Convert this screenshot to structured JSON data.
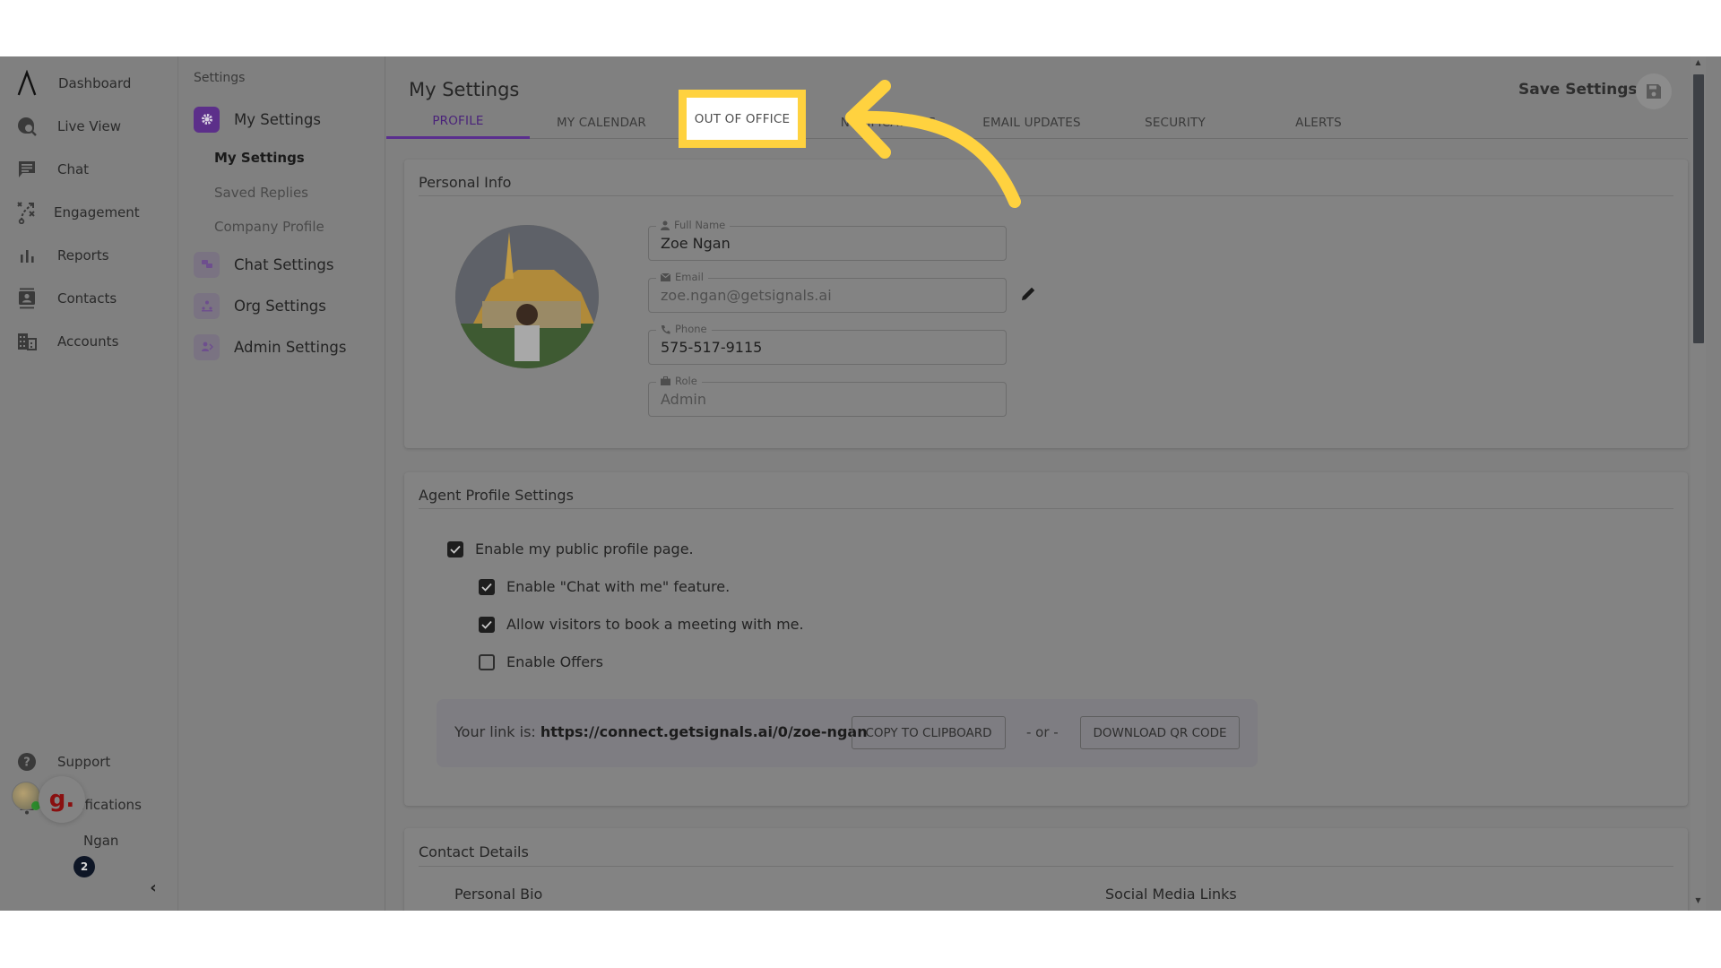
{
  "nav": {
    "items": [
      {
        "label": "Dashboard",
        "icon": "app-logo-icon"
      },
      {
        "label": "Live View",
        "icon": "live-view-icon"
      },
      {
        "label": "Chat",
        "icon": "chat-icon"
      },
      {
        "label": "Engagement",
        "icon": "engagement-icon"
      },
      {
        "label": "Reports",
        "icon": "bar-chart-icon"
      },
      {
        "label": "Contacts",
        "icon": "contacts-icon"
      },
      {
        "label": "Accounts",
        "icon": "building-icon"
      }
    ],
    "bottom": [
      {
        "label": "Support",
        "icon": "help-icon"
      },
      {
        "label": "Notifications",
        "icon": "bell-icon"
      }
    ],
    "user_name": "Ngan",
    "widget_glyph": "g.",
    "widget_badge": "2",
    "collapse_glyph": "‹"
  },
  "subnav": {
    "title": "Settings",
    "groups": [
      {
        "label": "My Settings",
        "active": true
      },
      {
        "label": "Chat Settings"
      },
      {
        "label": "Org Settings"
      },
      {
        "label": "Admin Settings"
      }
    ],
    "items": [
      "My Settings",
      "Saved Replies",
      "Company Profile"
    ]
  },
  "header": {
    "title": "My Settings",
    "save_label": "Save Settings",
    "tabs": [
      "PROFILE",
      "MY CALENDAR",
      "OUT OF OFFICE",
      "NOTIFICATIONS",
      "EMAIL UPDATES",
      "SECURITY",
      "ALERTS"
    ],
    "active_tab": "PROFILE",
    "highlighted_tab": "OUT OF OFFICE"
  },
  "personal_info": {
    "title": "Personal Info",
    "fields": [
      {
        "label": "Full Name",
        "value": "Zoe Ngan",
        "icon": "person-icon"
      },
      {
        "label": "Email",
        "value": "zoe.ngan@getsignals.ai",
        "icon": "mail-icon"
      },
      {
        "label": "Phone",
        "value": "575-517-9115",
        "icon": "phone-icon"
      },
      {
        "label": "Role",
        "value": "Admin",
        "icon": "briefcase-icon"
      }
    ]
  },
  "agent_profile": {
    "title": "Agent Profile Settings",
    "options": [
      {
        "label": "Enable my public profile page.",
        "checked": true
      },
      {
        "label": "Enable \"Chat with me\" feature.",
        "checked": true
      },
      {
        "label": "Allow visitors to book a meeting with me.",
        "checked": true
      },
      {
        "label": "Enable Offers",
        "checked": false
      }
    ],
    "link_prefix": "Your link is: ",
    "link_url": "https://connect.getsignals.ai/0/zoe-ngan",
    "copy_label": "COPY TO CLIPBOARD",
    "or_label": "- or -",
    "qr_label": "DOWNLOAD QR CODE"
  },
  "contact_details": {
    "title": "Contact Details",
    "bio_label": "Personal Bio",
    "social_label": "Social Media Links"
  },
  "colors": {
    "accent": "#5a2e8e",
    "highlight": "#ffd23f",
    "overlay": "#808080"
  }
}
